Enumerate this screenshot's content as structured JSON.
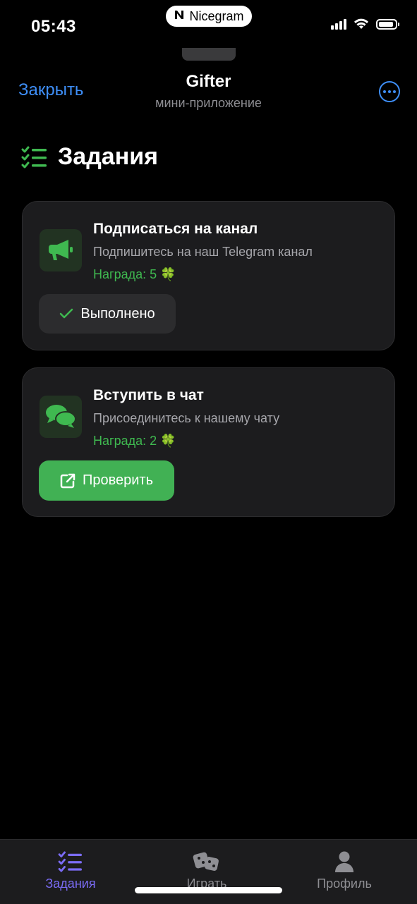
{
  "status_bar": {
    "time": "05:43",
    "app_pill": "Nicegram"
  },
  "header": {
    "close_label": "Закрыть",
    "title": "Gifter",
    "subtitle": "мини-приложение",
    "more_icon": "ellipsis-circle-icon"
  },
  "page": {
    "title": "Задания",
    "title_icon": "checklist-icon"
  },
  "tasks": [
    {
      "title": "Подписаться на канал",
      "description": "Подпишитесь на наш Telegram канал",
      "reward": "Награда: 5 🍀",
      "icon": "megaphone-icon",
      "button_label": "Выполнено",
      "button_state": "completed"
    },
    {
      "title": "Вступить в чат",
      "description": "Присоединитесь к нашему чату",
      "reward": "Награда: 2 🍀",
      "icon": "chat-bubbles-icon",
      "button_label": "Проверить",
      "button_state": "pending"
    }
  ],
  "bottom_nav": {
    "items": [
      {
        "label": "Задания",
        "icon": "checklist-icon",
        "active": true
      },
      {
        "label": "Играть",
        "icon": "dice-icon",
        "active": false
      },
      {
        "label": "Профиль",
        "icon": "user-icon",
        "active": false
      }
    ]
  },
  "colors": {
    "accent_blue": "#3e8ef7",
    "success_green": "#41b154",
    "reward_green": "#3fb950",
    "nav_active": "#7b6cf6",
    "card_bg": "#1c1c1e"
  }
}
